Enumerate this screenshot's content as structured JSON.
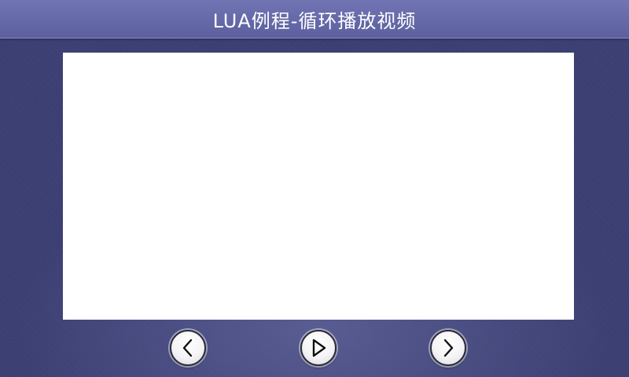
{
  "header": {
    "title": "LUA例程-循环播放视频"
  },
  "video": {
    "content": ""
  },
  "controls": {
    "prev_icon": "chevron-left-icon",
    "play_icon": "play-icon",
    "next_icon": "chevron-right-icon"
  },
  "colors": {
    "background": "#3c3f74",
    "title_bar": "#6569a8",
    "video_area": "#ffffff",
    "button_face": "#f4f4f6",
    "button_border": "#2c2c3a"
  }
}
